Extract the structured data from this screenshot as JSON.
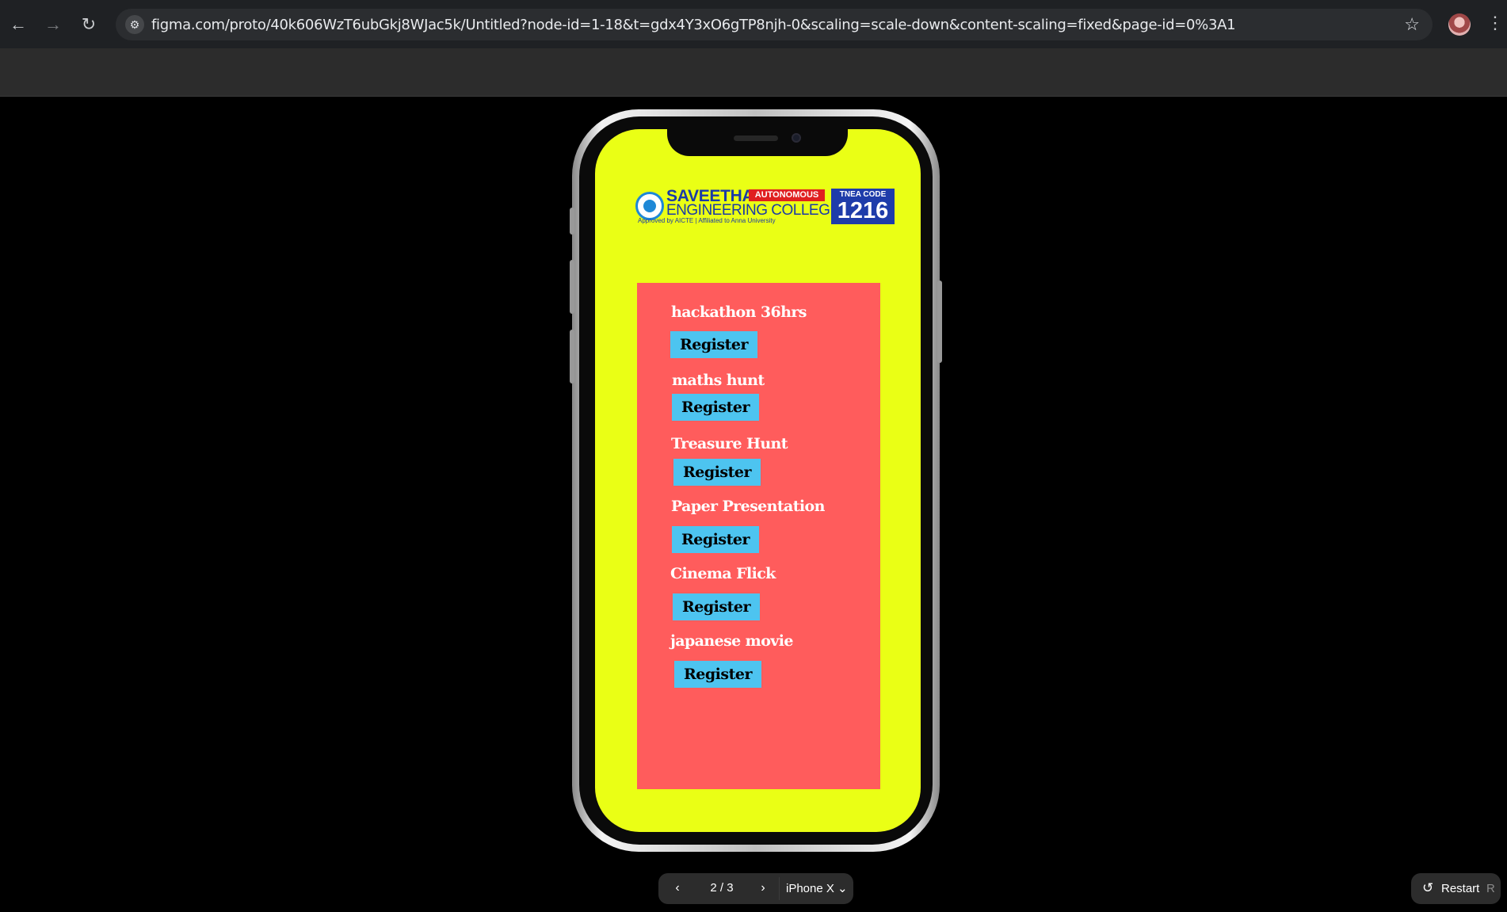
{
  "browser": {
    "url": "figma.com/proto/40k606WzT6ubGkj8WJac5k/Untitled?node-id=1-18&t=gdx4Y3xO6gTP8njh-0&scaling=scale-down&content-scaling=fixed&page-id=0%3A1",
    "back_icon": "←",
    "forward_icon": "→",
    "reload_icon": "↻",
    "site_icon": "⚙",
    "star_icon": "☆",
    "menu_icon": "⋮"
  },
  "logo": {
    "name_line1": "SAVEETHA",
    "badge": "AUTONOMOUS",
    "name_line2": "ENGINEERING COLLEGE",
    "subtitle": "Approved by AICTE  |  Affiliated to Anna University",
    "tnea_label": "TNEA CODE",
    "tnea_code": "1216"
  },
  "colors": {
    "screen_bg": "#eaff15",
    "panel_bg": "#ff5c5c",
    "button_bg": "#4dc4f0"
  },
  "events": [
    {
      "title": "hackathon 36hrs",
      "button": "Register"
    },
    {
      "title": "maths hunt",
      "button": "Register"
    },
    {
      "title": "Treasure Hunt",
      "button": "Register"
    },
    {
      "title": "Paper Presentation",
      "button": "Register"
    },
    {
      "title": "Cinema Flick",
      "button": "Register"
    },
    {
      "title": "japanese movie",
      "button": "Register"
    }
  ],
  "controls": {
    "prev_icon": "‹",
    "page": "2 / 3",
    "next_icon": "›",
    "device": "iPhone X ⌄",
    "restart_icon": "↺",
    "restart_label": "Restart",
    "restart_key": "R"
  }
}
